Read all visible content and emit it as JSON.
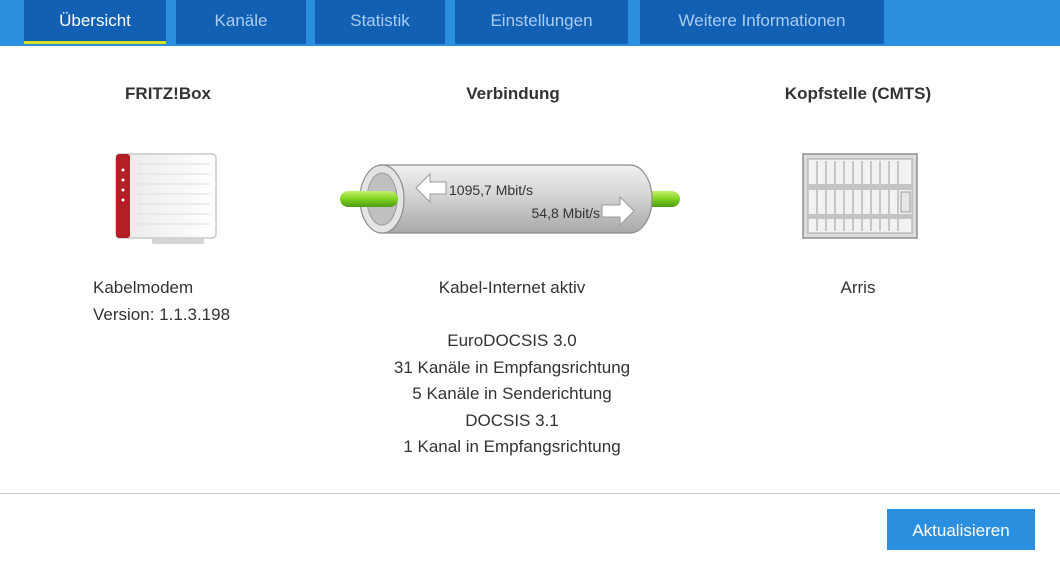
{
  "tabs": [
    {
      "label": "Übersicht",
      "active": true
    },
    {
      "label": "Kanäle",
      "active": false
    },
    {
      "label": "Statistik",
      "active": false
    },
    {
      "label": "Einstellungen",
      "active": false
    },
    {
      "label": "Weitere Informationen",
      "active": false
    }
  ],
  "fritzbox": {
    "title": "FRITZ!Box",
    "icon": "router-icon",
    "line1": "Kabelmodem",
    "line2": "Version: 1.1.3.198"
  },
  "connection": {
    "title": "Verbindung",
    "icon": "cable-pipe-icon",
    "downstream": "1095,7 Mbit/s",
    "upstream": "54,8 Mbit/s",
    "status": "Kabel-Internet aktiv",
    "details": [
      "EuroDOCSIS 3.0",
      "31 Kanäle in Empfangsrichtung",
      "5 Kanäle in Senderichtung",
      "DOCSIS 3.1",
      "1 Kanal in Empfangsrichtung"
    ]
  },
  "cmts": {
    "title": "Kopfstelle (CMTS)",
    "icon": "server-rack-icon",
    "vendor": "Arris"
  },
  "footer": {
    "refresh_label": "Aktualisieren"
  },
  "colors": {
    "tab_bg": "#1160b4",
    "bar_bg": "#2b8fe0",
    "active_underline": "#d6e21f",
    "button": "#2b8fe0",
    "link_green": "#7ed321"
  }
}
